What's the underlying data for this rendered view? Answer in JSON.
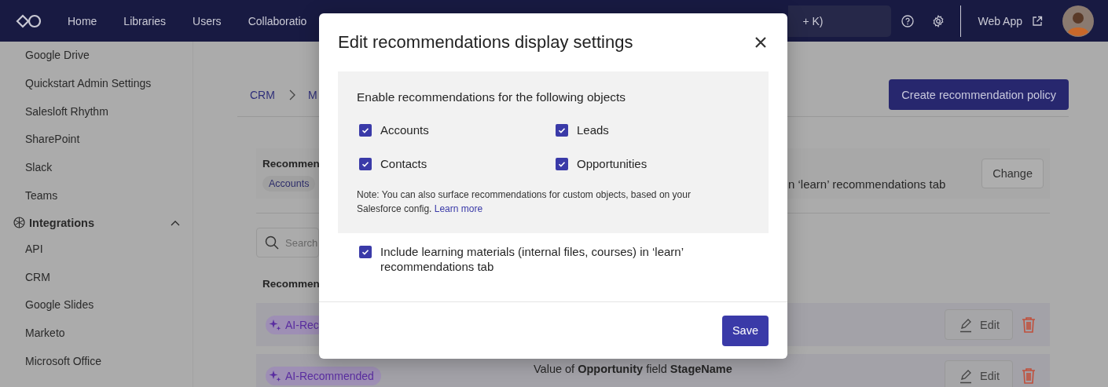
{
  "nav": {
    "items": [
      "Home",
      "Libraries",
      "Users",
      "Collaboratio"
    ],
    "search": {
      "placeholder": "+ K)"
    },
    "web_app_link": "Web App"
  },
  "sidebar": {
    "items": [
      "Google Drive",
      "Quickstart Admin Settings",
      "Salesloft Rhythm",
      "SharePoint",
      "Slack",
      "Teams"
    ],
    "section": {
      "label": "Integrations",
      "expanded": true,
      "children": [
        "API",
        "CRM",
        "Google Slides",
        "Marketo",
        "Microsoft Office"
      ]
    }
  },
  "main": {
    "breadcrumb": [
      "CRM",
      "M"
    ],
    "create_button": "Create recommendation policy",
    "settings_panel": {
      "title": "Recommen",
      "tags": [
        "Accounts"
      ],
      "description": "n ‘learn’ recommendations tab",
      "change_button": "Change"
    },
    "search": {
      "placeholder": "Search"
    },
    "list_heading": "Recommen",
    "rows": [
      {
        "badge": "AI-Rec",
        "edit_button": "Edit"
      },
      {
        "badge": "AI-Recommended",
        "condition": "Value of **Opportunity** field **StageName**",
        "edit_button": "Edit"
      }
    ]
  },
  "modal": {
    "title": "Edit recommendations display settings",
    "section_heading": "Enable recommendations for the following objects",
    "objects": [
      {
        "label": "Accounts",
        "checked": true
      },
      {
        "label": "Leads",
        "checked": true
      },
      {
        "label": "Contacts",
        "checked": true
      },
      {
        "label": "Opportunities",
        "checked": true
      }
    ],
    "note": "Note: You can also surface recommendations for custom objects, based on your Salesforce config.",
    "note_link": "Learn more",
    "include": {
      "label": "Include learning materials (internal files, courses) in ‘learn’ recommendations tab",
      "checked": true
    },
    "save_button": "Save"
  }
}
